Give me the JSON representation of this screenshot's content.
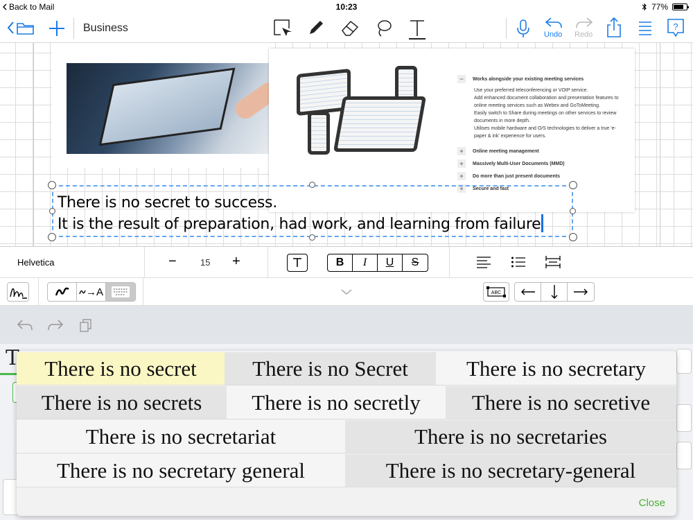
{
  "status_bar": {
    "back_label": "Back to Mail",
    "time": "10:23",
    "battery": "77%",
    "battery_level": 0.77
  },
  "toolbar": {
    "document_title": "Business",
    "undo_label": "Undo",
    "redo_label": "Redo"
  },
  "document": {
    "panel_items": [
      {
        "toggle": "−",
        "title": "Works alongside your existing meeting services",
        "desc": "Use your preferred teleconferencing or VOIP service.\nAdd enhanced document collaboration and presentation features to online meeting services such as Webex and GoToMeeting.\nEasily switch to Share during meetings on other services to review documents in more depth.\nUtilises mobile hardware and O/S technologies to deliver a true 'e-paper & ink' experience for users."
      },
      {
        "toggle": "+",
        "title": "Online meeting management"
      },
      {
        "toggle": "+",
        "title": "Massively Multi-User Documents (MMD)"
      },
      {
        "toggle": "+",
        "title": "Do more than just present documents"
      },
      {
        "toggle": "+",
        "title": "Secure and fast"
      }
    ],
    "text_line1": "There is no secret to success.",
    "text_line2": "It is the result of preparation, had work, and learning from failure"
  },
  "format_bar": {
    "font_name": "Helvetica",
    "font_size": "15",
    "decrease": "−",
    "increase": "+"
  },
  "handwriting_bar": {
    "convert_label": "→A",
    "abc_label": "ABC"
  },
  "candidates": {
    "rows": [
      [
        "There is no secret",
        "There is no Secret",
        "There is no secretary"
      ],
      [
        "There is no secrets",
        "There is no secretly",
        "There is no secretive"
      ],
      [
        "There is no secretariat",
        "There is no secretaries"
      ],
      [
        "There is no secretary general",
        "There is no secretary-general"
      ]
    ],
    "close_label": "Close"
  },
  "colors": {
    "accent": "#1a7ce6",
    "selection": "#fbf7c5",
    "close": "#4caf35",
    "frame": "#66a6f0"
  }
}
